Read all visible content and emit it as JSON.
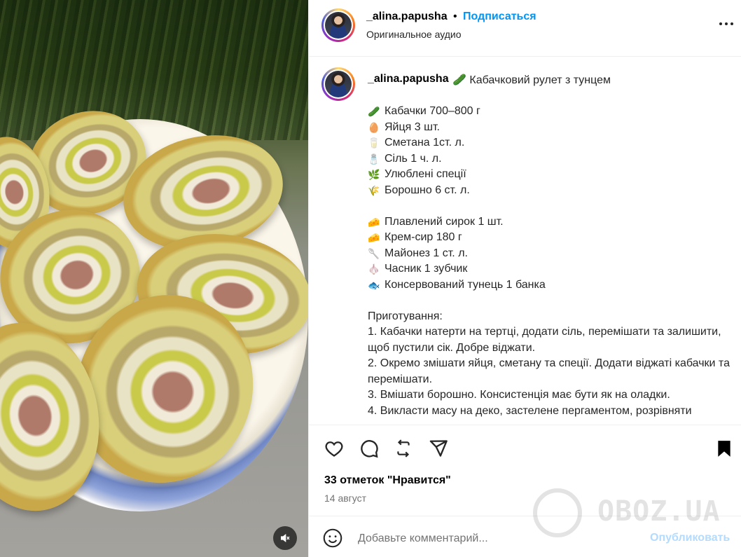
{
  "header": {
    "username": "_alina.papusha",
    "separator": "•",
    "follow_label": "Подписаться",
    "audio": "Оригинальное аудио",
    "more_icon": "more-horizontal-icon"
  },
  "caption": {
    "username": "_alina.papusha",
    "title": "🥒 Кабачковий рулет з тунцем",
    "ingredients_1": [
      {
        "emoji": "🥒",
        "text": "Кабачки 700–800 г"
      },
      {
        "emoji": "🥚",
        "text": "Яйця 3 шт."
      },
      {
        "emoji": "🥛",
        "text": "Сметана 1ст. л."
      },
      {
        "emoji": "🧂",
        "text": "Сіль 1 ч. л."
      },
      {
        "emoji": "🌿",
        "text": "Улюблені спеції"
      },
      {
        "emoji": "🌾",
        "text": "Борошно 6 ст. л."
      }
    ],
    "ingredients_2": [
      {
        "emoji": "🧀",
        "text": "Плавлений сирок 1 шт."
      },
      {
        "emoji": "🧀",
        "text": "Крем-сир 180 г"
      },
      {
        "emoji": "🥄",
        "text": "Майонез 1 ст. л."
      },
      {
        "emoji": "🧄",
        "text": "Часник 1 зубчик"
      },
      {
        "emoji": "🐟",
        "text": "Консервований тунець 1 банка"
      }
    ],
    "steps_title": "Приготування:",
    "steps": [
      "1. Кабачки натерти на тертці, додати сіль, перемішати та залишити, щоб пустили сік. Добре віджати.",
      "2. Окремо змішати яйця, сметану та спеції. Додати віджаті кабачки та перемішати.",
      "3. Вмішати борошно. Консистенція має бути як на оладки.",
      "4. Викласти масу на деко, застелене пергаментом, розрівняти"
    ]
  },
  "actions": {
    "like_icon": "heart-icon",
    "comment_icon": "comment-icon",
    "repost_icon": "repost-icon",
    "share_icon": "send-icon",
    "save_icon": "bookmark-icon",
    "likes_text": "33 отметок \"Нравится\"",
    "date": "14 август"
  },
  "comment": {
    "placeholder": "Добавьте комментарий...",
    "publish_label": "Опубликовать",
    "emoji_icon": "smiley-icon"
  },
  "media": {
    "mute_icon": "speaker-muted-icon"
  },
  "watermark": {
    "text": "OBOZ.UA"
  },
  "colors": {
    "link": "#0095f6",
    "publish_disabled": "#b3dbff",
    "muted_text": "#737373",
    "border": "#efefef"
  }
}
